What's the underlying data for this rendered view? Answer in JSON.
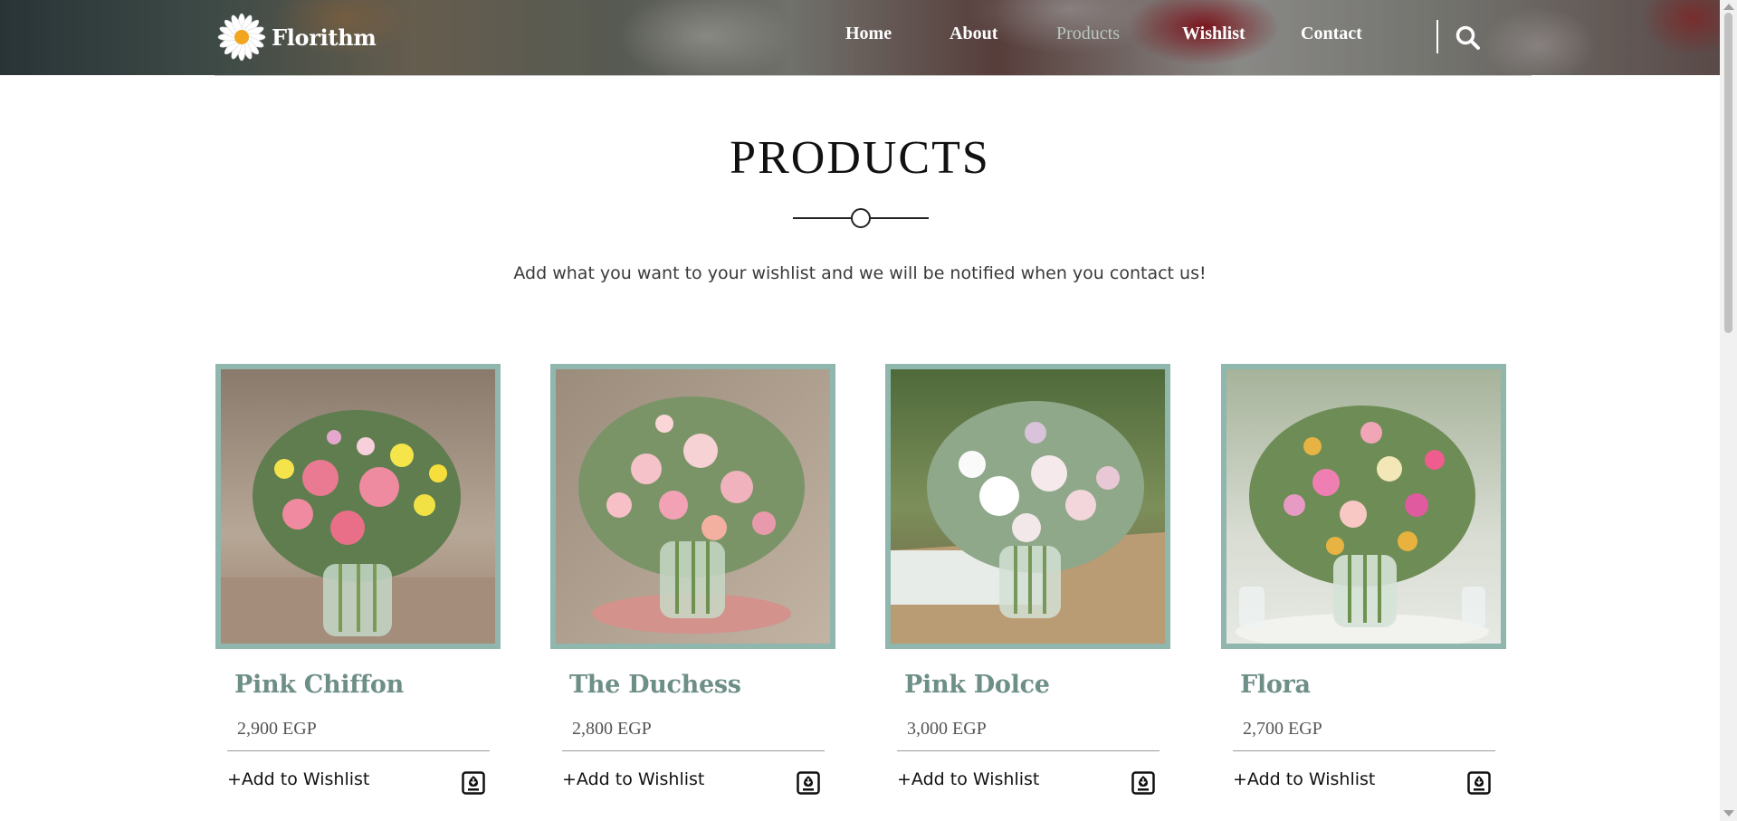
{
  "brand": {
    "name": "Florithm",
    "logo_icon": "daisy-logo-icon"
  },
  "nav": {
    "items": [
      {
        "label": "Home",
        "active": false
      },
      {
        "label": "About",
        "active": false
      },
      {
        "label": "Products",
        "active": true
      },
      {
        "label": "Wishlist",
        "active": false
      },
      {
        "label": "Contact",
        "active": false
      }
    ],
    "search_icon": "search-icon"
  },
  "main": {
    "title": "PRODUCTS",
    "subtitle": "Add what you want to your wishlist and we will be notified when you contact us!"
  },
  "products": [
    {
      "name": "Pink Chiffon",
      "price": "2,900 EGP",
      "action": "+Add to Wishlist",
      "action_icon": "save-to-wishlist-icon"
    },
    {
      "name": "The Duchess",
      "price": "2,800 EGP",
      "action": "+Add to Wishlist",
      "action_icon": "save-to-wishlist-icon"
    },
    {
      "name": "Pink Dolce",
      "price": "3,000 EGP",
      "action": "+Add to Wishlist",
      "action_icon": "save-to-wishlist-icon"
    },
    {
      "name": "Flora",
      "price": "2,700 EGP",
      "action": "+Add to Wishlist",
      "action_icon": "save-to-wishlist-icon"
    }
  ],
  "colors": {
    "accent": "#8fb7ae",
    "product_name": "#6e8f88",
    "nav_active": "#b8c6c0"
  }
}
